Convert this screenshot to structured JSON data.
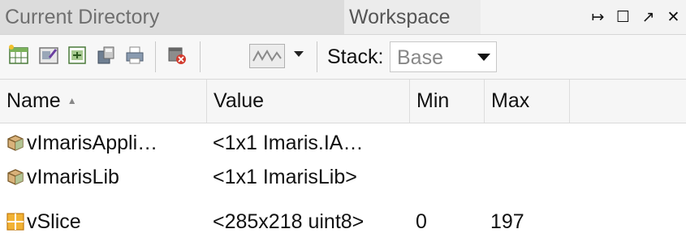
{
  "tabs": {
    "current_directory": "Current Directory",
    "workspace": "Workspace"
  },
  "window_controls": {
    "undock": "↦",
    "maximize": "☐",
    "popout": "↗",
    "close": "✕"
  },
  "toolbar": {
    "stack_label": "Stack:",
    "stack_value": "Base"
  },
  "columns": {
    "name": "Name",
    "value": "Value",
    "min": "Min",
    "max": "Max"
  },
  "rows": [
    {
      "name": "vImarisAppli…",
      "value": "<1x1 Imaris.IA…",
      "min": "",
      "max": "",
      "icon": "object-icon"
    },
    {
      "name": "vImarisLib",
      "value": "<1x1 ImarisLib>",
      "min": "",
      "max": "",
      "icon": "object-icon"
    },
    {
      "name": "vSlice",
      "value": "<285x218 uint8>",
      "min": "0",
      "max": "197",
      "icon": "matrix-icon"
    }
  ],
  "colors": {
    "matrix_icon": "#e8a010",
    "object_icon": "#b8864a"
  }
}
